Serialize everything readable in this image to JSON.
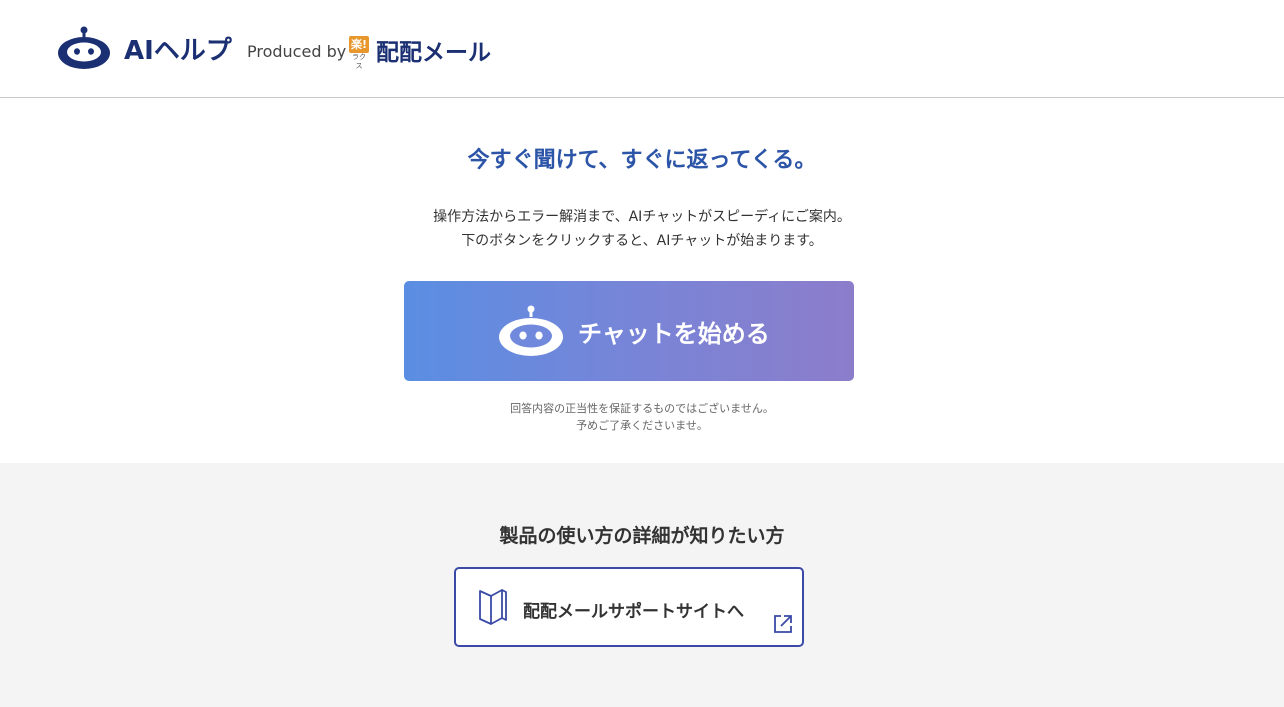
{
  "header": {
    "title": "AIヘルプ",
    "produced_by": "Produced by",
    "brand_mark_top": "楽!",
    "brand_mark_bottom": "ラクス",
    "brand_name": "配配メール",
    "logo_icon": "robot-icon",
    "brand_color": "#1b2f73"
  },
  "hero": {
    "title": "今すぐ聞けて、すぐに返ってくる。",
    "description": [
      "操作方法からエラー解消まで、AIチャットがスピーディにご案内。",
      "下のボタンをクリックすると、AIチャットが始まります。"
    ],
    "title_color": "#2c55a8"
  },
  "chat_button": {
    "label": "チャットを始める",
    "icon": "robot-icon",
    "gradient_start": "#5a8ee3",
    "gradient_end": "#8c7dcb"
  },
  "disclaimer": {
    "lines": [
      "回答内容の正当性を保証するものではございません。",
      "予めご了承くださいませ。"
    ]
  },
  "support": {
    "title": "製品の使い方の詳細が知りたい方",
    "button_label": "配配メールサポートサイトへ",
    "button_icon": "book-icon",
    "external_icon": "external-link-icon",
    "border_color": "#3a4aa6"
  }
}
